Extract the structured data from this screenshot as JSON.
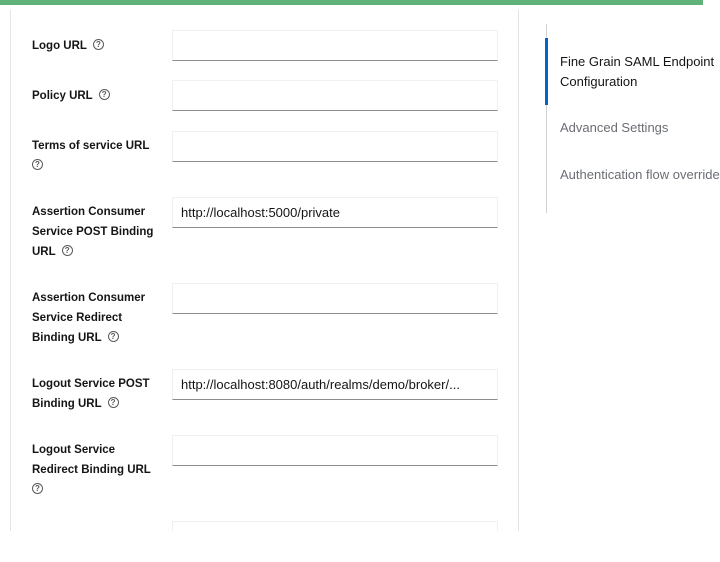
{
  "fields": [
    {
      "label": "Logo URL",
      "value": "",
      "placeholder": ""
    },
    {
      "label": "Policy URL",
      "value": "",
      "placeholder": ""
    },
    {
      "label": "Terms of service URL",
      "value": "",
      "placeholder": ""
    },
    {
      "label": "Assertion Consumer Service POST Binding URL",
      "value": "http://localhost:5000/private",
      "placeholder": ""
    },
    {
      "label": "Assertion Consumer Service Redirect Binding URL",
      "value": "",
      "placeholder": ""
    },
    {
      "label": "Logout Service POST Binding URL",
      "value": "http://localhost:8080/auth/realms/demo/broker/...",
      "placeholder": ""
    },
    {
      "label": "Logout Service Redirect Binding URL",
      "value": "",
      "placeholder": ""
    },
    {
      "label": "",
      "value": "",
      "placeholder": ""
    }
  ],
  "jump_links": [
    {
      "label_line1": "Fine Grain SAML Endpoint",
      "label_line2": "Configuration"
    },
    {
      "label": "Advanced Settings"
    },
    {
      "label": "Authentication flow overrides"
    }
  ],
  "icons": {
    "help": "help-icon",
    "help_glyph": "?"
  },
  "colors": {
    "accent": "#0066cc",
    "top_bar": "#5fb37a"
  }
}
